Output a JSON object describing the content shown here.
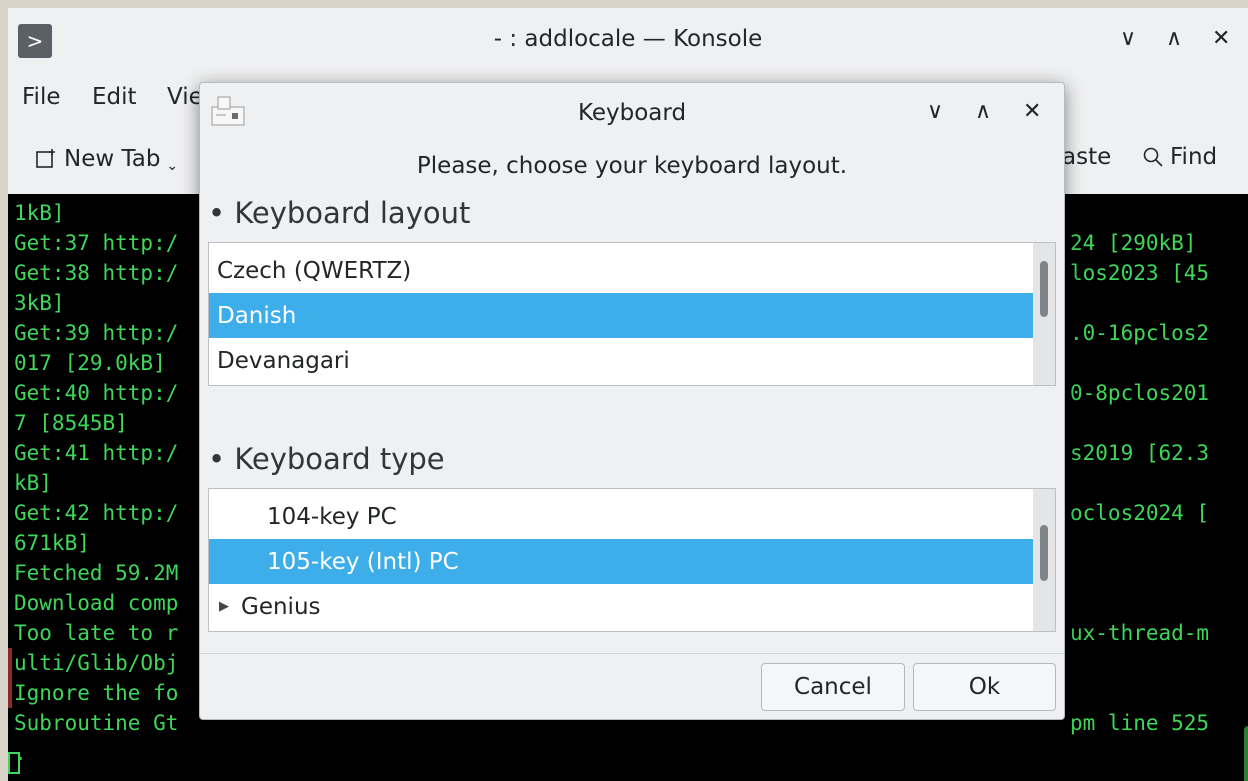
{
  "konsole": {
    "title": "- : addlocale — Konsole",
    "app_icon_glyph": ">",
    "window_buttons": {
      "minimize": "∨",
      "maximize": "∧",
      "close": "✕"
    },
    "menu": {
      "file": "File",
      "edit": "Edit",
      "view_partial": "Vie"
    },
    "toolbar": {
      "new_tab": "New Tab",
      "new_tab_arrow": "⌄",
      "paste_partial": "aste",
      "find": "Find"
    }
  },
  "terminal": {
    "left_lines": [
      "1kB]",
      "Get:37 http:/",
      "Get:38 http:/",
      "3kB]",
      "Get:39 http:/",
      "017 [29.0kB]",
      "Get:40 http:/",
      "7 [8545B]",
      "Get:41 http:/",
      "kB]",
      "Get:42 http:/",
      "671kB]",
      "Fetched 59.2M",
      "Download comp",
      "Too late to r",
      "ulti/Glib/Obj",
      "Ignore the fo",
      "Subroutine Gt",
      "."
    ],
    "right_lines": [
      "",
      "24 [290kB]",
      "los2023 [45",
      "",
      ".0-16pclos2",
      "",
      "0-8pclos201",
      "",
      "s2019 [62.3",
      "",
      "oclos2024 [",
      "",
      "",
      "",
      "ux-thread-m",
      "",
      "",
      "pm line 525",
      ""
    ]
  },
  "dialog": {
    "title": "Keyboard",
    "window_buttons": {
      "minimize": "∨",
      "maximize": "∧",
      "close": "✕"
    },
    "prompt": "Please, choose your keyboard layout.",
    "layout_section": "• Keyboard layout",
    "layouts": [
      "Czech (QWERTZ)",
      "Danish",
      "Devanagari"
    ],
    "type_section": "• Keyboard type",
    "types": [
      "104-key PC",
      "105-key (Intl) PC",
      "Genius"
    ],
    "tree_arrow": "▶",
    "cancel": "Cancel",
    "ok": "Ok"
  }
}
